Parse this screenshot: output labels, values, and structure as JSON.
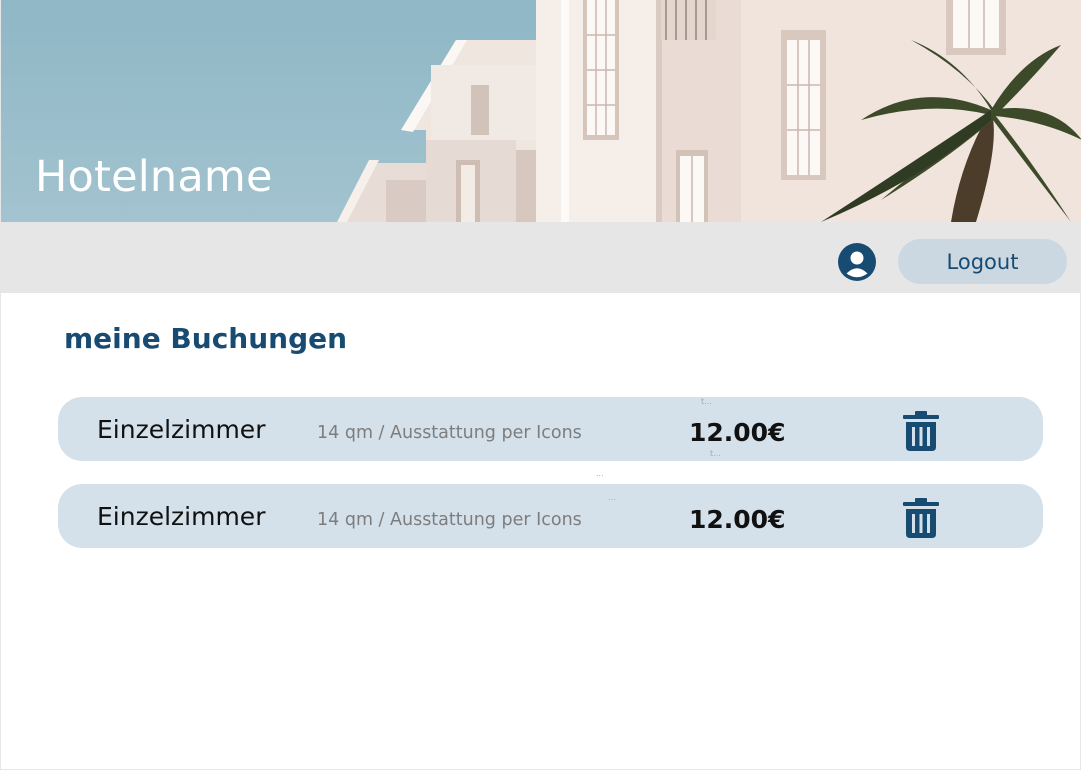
{
  "header": {
    "hotel_name": "Hotelname"
  },
  "navbar": {
    "user_icon": "user-circle-icon",
    "logout_label": "Logout"
  },
  "main": {
    "title": "meine Buchungen",
    "bookings": [
      {
        "room": "Einzelzimmer",
        "description": "14 qm / Ausstattung per Icons",
        "price": "12.00€",
        "delete_icon": "trash-icon"
      },
      {
        "room": "Einzelzimmer",
        "description": "14 qm / Ausstattung per Icons",
        "price": "12.00€",
        "delete_icon": "trash-icon"
      }
    ],
    "hints": [
      "t...",
      "t...",
      "...",
      "..."
    ]
  },
  "colors": {
    "accent": "#174b72",
    "card": "#d4e1eb",
    "navbar": "#e6e6e6",
    "button": "#cbd8e2"
  }
}
